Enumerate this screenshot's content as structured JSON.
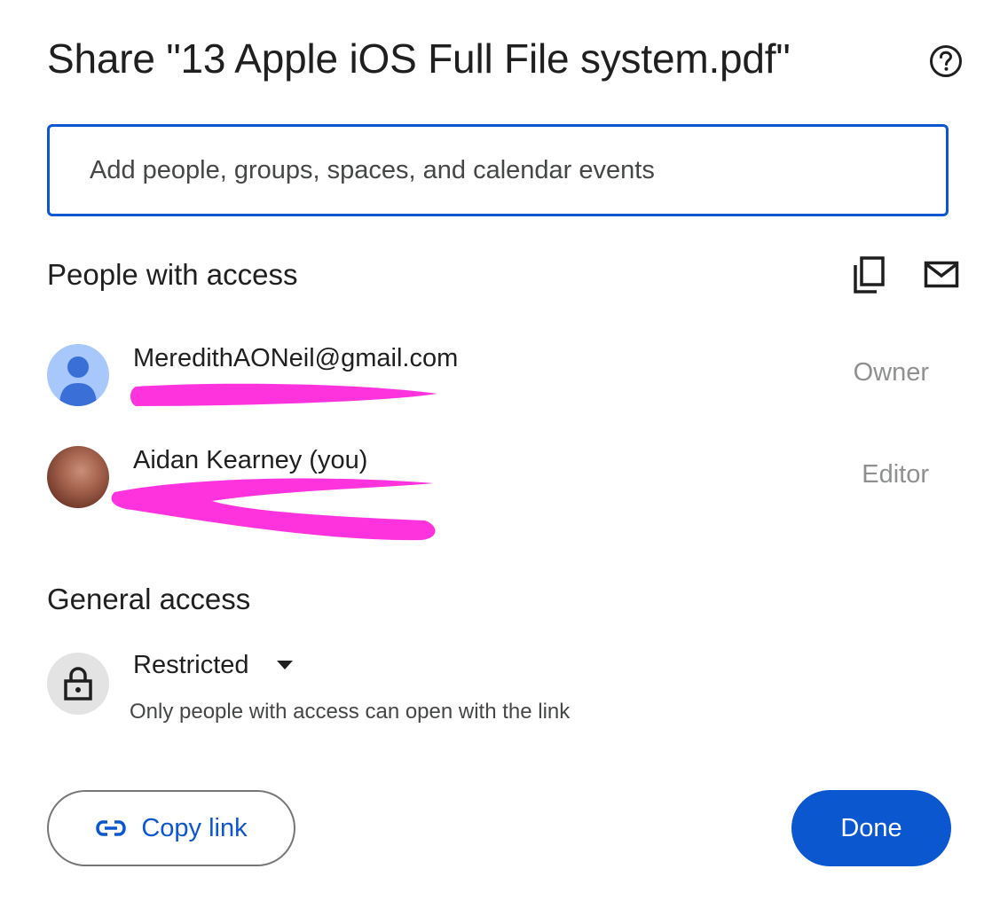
{
  "dialog": {
    "title": "Share \"13 Apple iOS Full File system.pdf\"",
    "help_icon": "help-circle-icon",
    "search": {
      "placeholder": "Add people, groups, spaces, and calendar events",
      "value": ""
    },
    "people_with_access": {
      "heading": "People with access",
      "copy_emails_icon": "copy-icon",
      "email_icon": "mail-icon",
      "people": [
        {
          "name": "MeredithAONeil@gmail.com",
          "email": "",
          "role": "Owner",
          "avatar": "default-avatar-icon"
        },
        {
          "name": "Aidan Kearney (you)",
          "email": "",
          "role": "Editor",
          "avatar": "profile-photo"
        }
      ]
    },
    "general_access": {
      "heading": "General access",
      "icon": "lock-icon",
      "selected": "Restricted",
      "dropdown_icon": "caret-down-icon",
      "description": "Only people with access can open with the link"
    },
    "footer": {
      "copy_link_label": "Copy link",
      "copy_link_icon": "link-icon",
      "done_label": "Done"
    },
    "colors": {
      "accent": "#0b57d0",
      "redaction": "#ff33dd",
      "role_text": "#8e918f",
      "avatar_default": "#a8c7fa",
      "avatar_figure": "#3b6fd8"
    }
  }
}
